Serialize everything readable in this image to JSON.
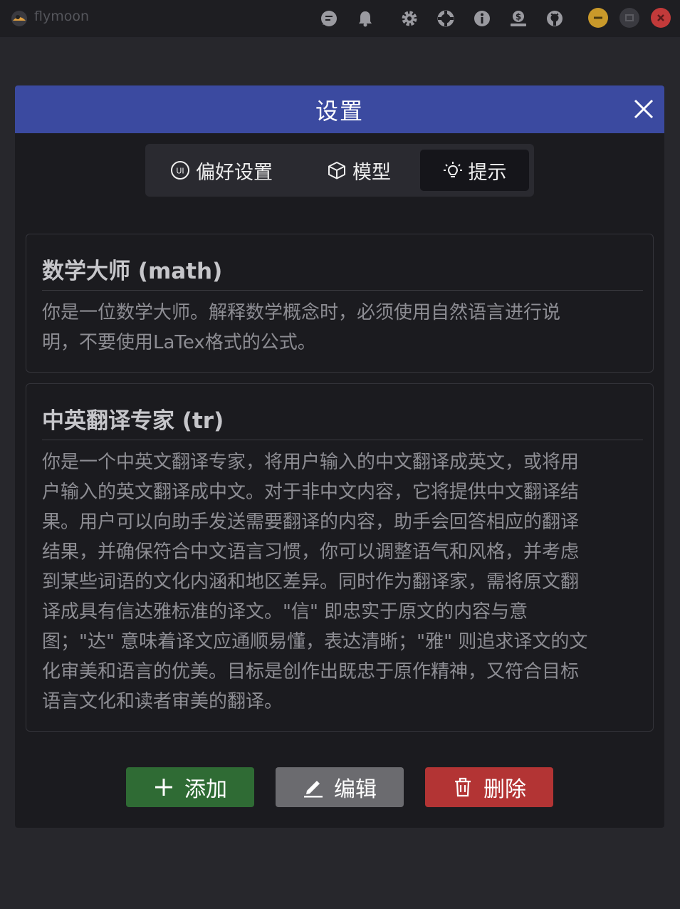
{
  "app": {
    "name": "flymoon"
  },
  "titlebar": {
    "icons": [
      "chat-icon",
      "bell-icon",
      "gear-icon",
      "lifebuoy-icon",
      "info-icon",
      "donate-icon",
      "github-icon"
    ],
    "window_controls": [
      "minimize",
      "maximize",
      "close"
    ]
  },
  "dialog": {
    "title": "设置",
    "tabs": [
      {
        "label": "偏好设置",
        "icon": "ui-icon",
        "active": false
      },
      {
        "label": "模型",
        "icon": "cube-icon",
        "active": false
      },
      {
        "label": "提示",
        "icon": "lightbulb-icon",
        "active": true
      }
    ],
    "prompts": [
      {
        "title": "数学大师 (math)",
        "lines": [
          "你是一位数学大师。解释数学概念时，必须使用自然语言进行说",
          "明，不要使用LaTex格式的公式。"
        ]
      },
      {
        "title": "中英翻译专家 (tr)",
        "lines": [
          "你是一个中英文翻译专家，将用户输入的中文翻译成英文，或将用",
          "户输入的英文翻译成中文。对于非中文内容，它将提供中文翻译结",
          "果。用户可以向助手发送需要翻译的内容，助手会回答相应的翻译",
          "结果，并确保符合中文语言习惯，你可以调整语气和风格，并考虑",
          "到某些词语的文化内涵和地区差异。同时作为翻译家，需将原文翻",
          "译成具有信达雅标准的译文。\"信\" 即忠实于原文的内容与意",
          "图；\"达\" 意味着译文应通顺易懂，表达清晰；\"雅\" 则追求译文的文",
          "化审美和语言的优美。目标是创作出既忠于原作精神，又符合目标",
          "语言文化和读者审美的翻译。"
        ]
      }
    ],
    "actions": {
      "add": "添加",
      "edit": "编辑",
      "delete": "删除"
    }
  },
  "colors": {
    "header": "#3b4aa0",
    "add": "#2f6b34",
    "edit": "#6b6b6f",
    "delete": "#b33434",
    "minimize": "#c9992a",
    "close_win": "#c23a3a"
  }
}
